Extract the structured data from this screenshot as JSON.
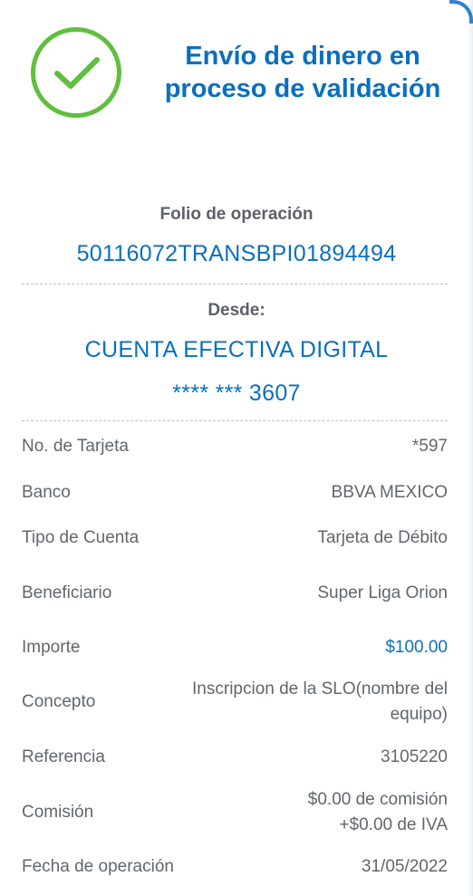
{
  "header": {
    "icon": "check-circle-icon",
    "title": "Envío de dinero en proceso de validación"
  },
  "folio": {
    "label": "Folio de operación",
    "value": "50116072TRANSBPI01894494"
  },
  "desde": {
    "label": "Desde:",
    "account_name": "CUENTA EFECTIVA DIGITAL",
    "account_number": "**** *** 3607"
  },
  "details": {
    "tarjeta": {
      "label": "No. de Tarjeta",
      "value": "*597"
    },
    "banco": {
      "label": "Banco",
      "value": "BBVA MEXICO"
    },
    "tipo_cuenta": {
      "label": "Tipo de Cuenta",
      "value": "Tarjeta de Débito"
    },
    "beneficiario": {
      "label": "Beneficiario",
      "value": "Super Liga Orion"
    },
    "importe": {
      "label": "Importe",
      "value": "$100.00"
    },
    "concepto": {
      "label": "Concepto",
      "value_line1": "Inscripcion de la SLO(nombre del",
      "value_line2": "equipo)"
    },
    "referencia": {
      "label": "Referencia",
      "value": "3105220"
    },
    "comision": {
      "label": "Comisión",
      "value_line1": "$0.00 de comisión",
      "value_line2": "+$0.00 de IVA"
    },
    "fecha": {
      "label": "Fecha de operación",
      "value": "31/05/2022"
    }
  },
  "colors": {
    "accent": "#0a6fc0",
    "success": "#5fbf3f",
    "text_muted": "#62666c"
  }
}
